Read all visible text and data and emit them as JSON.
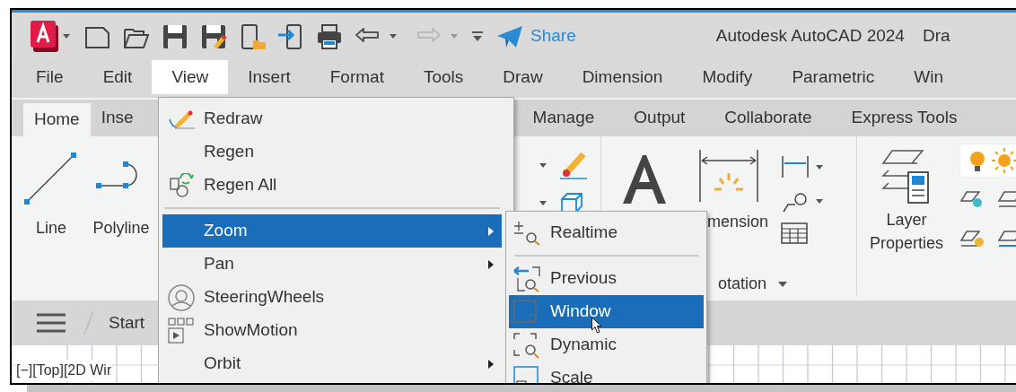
{
  "window": {
    "title": "Autodesk AutoCAD 2024",
    "document": "Dra"
  },
  "quick_access": {
    "share": "Share"
  },
  "menu_bar": [
    {
      "label": "File",
      "selected": false
    },
    {
      "label": "Edit",
      "selected": false
    },
    {
      "label": "View",
      "selected": true
    },
    {
      "label": "Insert",
      "selected": false
    },
    {
      "label": "Format",
      "selected": false
    },
    {
      "label": "Tools",
      "selected": false
    },
    {
      "label": "Draw",
      "selected": false
    },
    {
      "label": "Dimension",
      "selected": false
    },
    {
      "label": "Modify",
      "selected": false
    },
    {
      "label": "Parametric",
      "selected": false
    },
    {
      "label": "Win",
      "selected": false
    }
  ],
  "ribbon_tabs": [
    {
      "label": "Home",
      "selected": true
    },
    {
      "label": "Inse",
      "selected": false
    },
    {
      "label": "Manage",
      "selected": false
    },
    {
      "label": "Output",
      "selected": false
    },
    {
      "label": "Collaborate",
      "selected": false
    },
    {
      "label": "Express Tools",
      "selected": false
    }
  ],
  "ribbon": {
    "draw_tools": [
      {
        "label": "Line"
      },
      {
        "label": "Polyline"
      }
    ],
    "dimension_label": "mension",
    "panel_title": "otation",
    "layer_label": "Layer Properties"
  },
  "file_tabs": [
    {
      "label": "Start"
    }
  ],
  "viewport_label": "[−][Top][2D Wir",
  "view_menu": [
    {
      "kind": "item",
      "label": "Redraw",
      "selected": false,
      "submenu": false
    },
    {
      "kind": "item",
      "label": "Regen",
      "selected": false,
      "submenu": false
    },
    {
      "kind": "item",
      "label": "Regen All",
      "selected": false,
      "submenu": false
    },
    {
      "kind": "separator"
    },
    {
      "kind": "item",
      "label": "Zoom",
      "selected": true,
      "submenu": true
    },
    {
      "kind": "item",
      "label": "Pan",
      "selected": false,
      "submenu": true
    },
    {
      "kind": "item",
      "label": "SteeringWheels",
      "selected": false,
      "submenu": false
    },
    {
      "kind": "item",
      "label": "ShowMotion",
      "selected": false,
      "submenu": false
    },
    {
      "kind": "item",
      "label": "Orbit",
      "selected": false,
      "submenu": true
    }
  ],
  "zoom_submenu": [
    {
      "kind": "item",
      "label": "Realtime",
      "selected": false
    },
    {
      "kind": "separator"
    },
    {
      "kind": "item",
      "label": "Previous",
      "selected": false
    },
    {
      "kind": "item",
      "label": "Window",
      "selected": true
    },
    {
      "kind": "item",
      "label": "Dynamic",
      "selected": false
    },
    {
      "kind": "item",
      "label": "Scale",
      "selected": false
    }
  ]
}
